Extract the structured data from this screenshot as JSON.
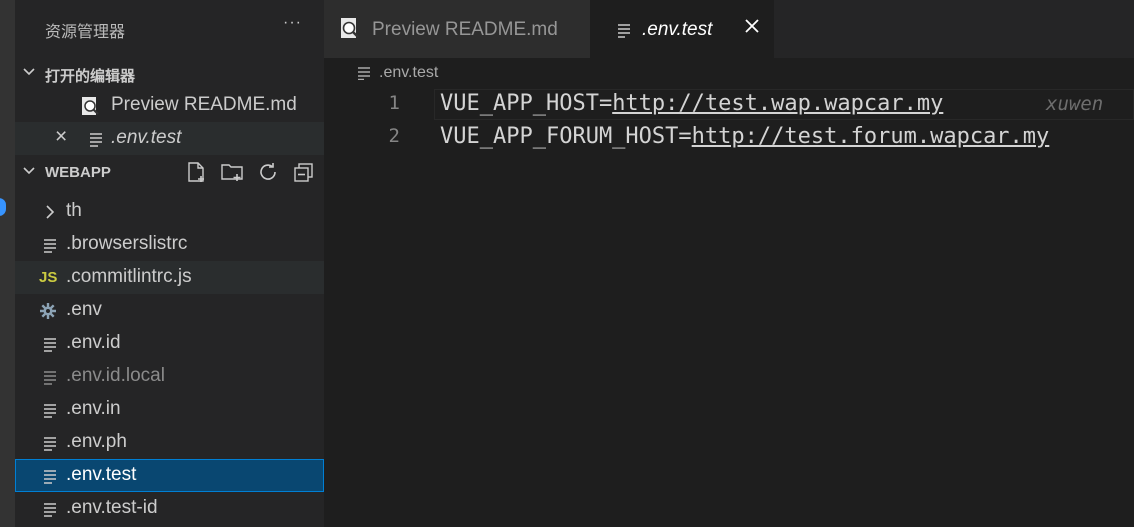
{
  "sidebar": {
    "title": "资源管理器",
    "more_label": "···",
    "open_editors": {
      "header": "打开的编辑器",
      "items": [
        {
          "label": "Preview README.md",
          "icon": "preview-icon"
        },
        {
          "label": ".env.test",
          "icon": "file-lines-icon",
          "close": "×"
        }
      ]
    },
    "workspace": {
      "header": "WEBAPP",
      "actions": [
        "new-file-icon",
        "new-folder-icon",
        "refresh-icon",
        "collapse-all-icon"
      ],
      "items": [
        {
          "label": "th",
          "type": "folder"
        },
        {
          "label": ".browserslistrc",
          "type": "file"
        },
        {
          "label": ".commitlintrc.js",
          "type": "js",
          "icon_text": "JS"
        },
        {
          "label": ".env",
          "type": "gear"
        },
        {
          "label": ".env.id",
          "type": "file"
        },
        {
          "label": ".env.id.local",
          "type": "file",
          "ignored": true
        },
        {
          "label": ".env.in",
          "type": "file"
        },
        {
          "label": ".env.ph",
          "type": "file"
        },
        {
          "label": ".env.test",
          "type": "file",
          "selected": true
        },
        {
          "label": ".env.test-id",
          "type": "file"
        }
      ]
    }
  },
  "tabs": [
    {
      "label": "Preview README.md",
      "active": false
    },
    {
      "label": ".env.test",
      "active": true
    }
  ],
  "breadcrumb": ".env.test",
  "editor": {
    "lines": [
      {
        "number": "1",
        "key": "VUE_APP_HOST=",
        "value": "http://test.wap.wapcar.my",
        "blame": "xuwen"
      },
      {
        "number": "2",
        "key": "VUE_APP_FORUM_HOST=",
        "value": "http://test.forum.wapcar.my"
      }
    ]
  },
  "colors": {
    "selection": "#094771",
    "selection_border": "#007fd4",
    "js_icon": "#cbcb41",
    "activity_badge": "#3794ff"
  }
}
